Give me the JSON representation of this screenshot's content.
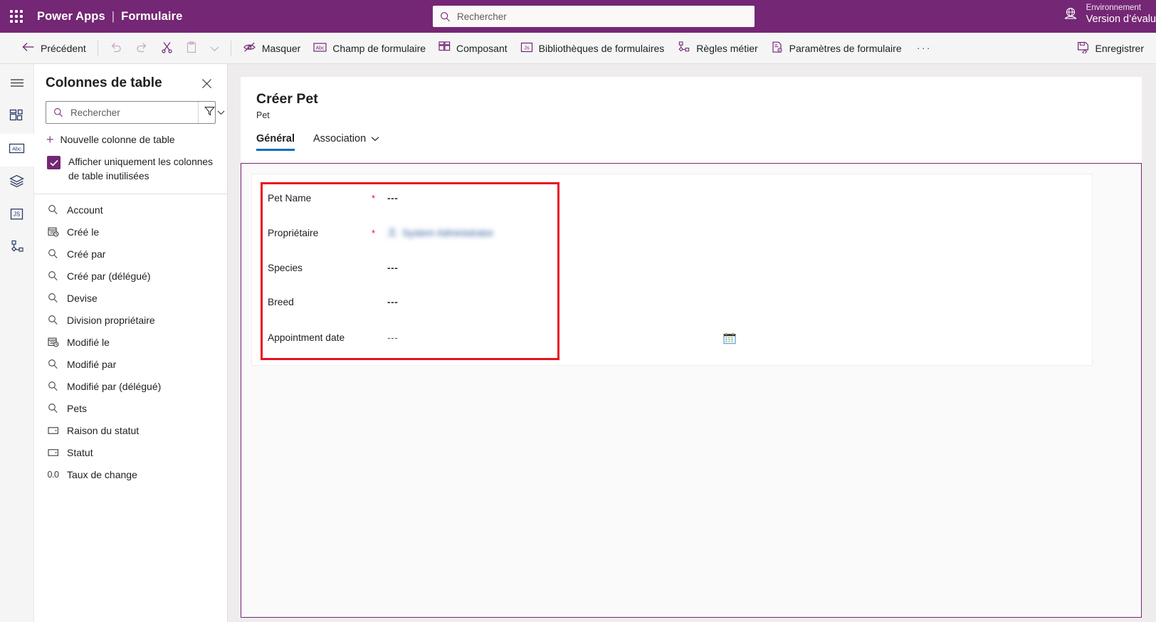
{
  "header": {
    "waffle_icon": "waffle-grid-icon",
    "brand": "Power Apps",
    "separator": "|",
    "app_context": "Formulaire",
    "search": {
      "icon": "search-icon",
      "placeholder": "Rechercher",
      "value": ""
    },
    "environment": {
      "icon": "environment-globe-icon",
      "label": "Environnement",
      "value": "Version d’évalu"
    }
  },
  "command_bar": {
    "back": {
      "icon": "arrow-left-icon",
      "label": "Précédent"
    },
    "undo": {
      "icon": "undo-icon",
      "label": ""
    },
    "redo": {
      "icon": "redo-icon",
      "label": ""
    },
    "cut": {
      "icon": "scissors-icon",
      "label": ""
    },
    "paste": {
      "icon": "clipboard-icon",
      "label": ""
    },
    "paste_more": {
      "icon": "chevron-down-icon",
      "label": ""
    },
    "hide": {
      "icon": "eye-slash-icon",
      "label": "Masquer"
    },
    "form_field": {
      "icon": "abc-icon",
      "label": "Champ de formulaire"
    },
    "component": {
      "icon": "component-grid-icon",
      "label": "Composant"
    },
    "form_libraries": {
      "icon": "js-icon",
      "label": "Bibliothèques de formulaires"
    },
    "business_rules": {
      "icon": "business-rules-icon",
      "label": "Règles métier"
    },
    "form_settings": {
      "icon": "form-settings-icon",
      "label": "Paramètres de formulaire"
    },
    "overflow": {
      "icon": "more-ellipsis-icon",
      "label": "···"
    },
    "save": {
      "icon": "save-icon",
      "label": "Enregistrer"
    }
  },
  "left_rail": {
    "items": [
      {
        "icon": "hamburger-menu-icon",
        "name": "rail-toggle-menu",
        "active": false
      },
      {
        "icon": "components-grid-icon",
        "name": "rail-components",
        "active": false
      },
      {
        "icon": "abc-table-columns-icon",
        "name": "rail-table-columns",
        "active": true
      },
      {
        "icon": "layers-icon",
        "name": "rail-tree-view",
        "active": false
      },
      {
        "icon": "js-icon",
        "name": "rail-form-libraries",
        "active": false
      },
      {
        "icon": "business-rules-icon",
        "name": "rail-business-rules",
        "active": false
      }
    ]
  },
  "columns_panel": {
    "title": "Colonnes de table",
    "close_icon": "close-icon",
    "search": {
      "icon": "search-icon",
      "placeholder": "Rechercher",
      "value": ""
    },
    "filter": {
      "icon": "filter-icon",
      "chevron": "chevron-down-icon"
    },
    "new_column": {
      "icon": "plus-icon",
      "label": "Nouvelle colonne de table"
    },
    "show_unused": {
      "checked": true,
      "check_icon": "checkmark-icon",
      "label": "Afficher uniquement les colonnes de table inutilisées"
    },
    "columns": [
      {
        "label": "Account",
        "icon": "lookup-search-icon"
      },
      {
        "label": "Créé le",
        "icon": "date-time-icon"
      },
      {
        "label": "Créé par",
        "icon": "lookup-search-icon"
      },
      {
        "label": "Créé par (délégué)",
        "icon": "lookup-search-icon"
      },
      {
        "label": "Devise",
        "icon": "lookup-search-icon"
      },
      {
        "label": "Division propriétaire",
        "icon": "lookup-search-icon"
      },
      {
        "label": "Modifié le",
        "icon": "date-time-icon"
      },
      {
        "label": "Modifié par",
        "icon": "lookup-search-icon"
      },
      {
        "label": "Modifié par (délégué)",
        "icon": "lookup-search-icon"
      },
      {
        "label": "Pets",
        "icon": "lookup-search-icon"
      },
      {
        "label": "Raison du statut",
        "icon": "choice-icon"
      },
      {
        "label": "Statut",
        "icon": "choice-icon"
      },
      {
        "label": "Taux de change",
        "icon": "decimal-number-icon",
        "glyph": "0.0"
      }
    ]
  },
  "form": {
    "title": "Créer Pet",
    "subtitle": "Pet",
    "tabs": [
      {
        "label": "Général",
        "active": true,
        "chevron": ""
      },
      {
        "label": "Association",
        "active": false,
        "chevron": "chevron-down-icon"
      }
    ],
    "fields": [
      {
        "label": "Pet Name",
        "required": "*",
        "value": "---",
        "type": "text"
      },
      {
        "label": "Propriétaire",
        "required": "*",
        "value": "System Administrator",
        "type": "owner",
        "icon": "person-icon"
      },
      {
        "label": "Species",
        "required": "",
        "value": "---",
        "type": "text"
      },
      {
        "label": "Breed",
        "required": "",
        "value": "---",
        "type": "text"
      },
      {
        "label": "Appointment date",
        "required": "",
        "value": "---",
        "type": "date",
        "icon": "calendar-icon"
      }
    ]
  },
  "colors": {
    "brand_purple": "#742774",
    "accent_blue": "#0f6cbd",
    "highlight_red": "#e81123",
    "selection_purple": "#742774"
  }
}
